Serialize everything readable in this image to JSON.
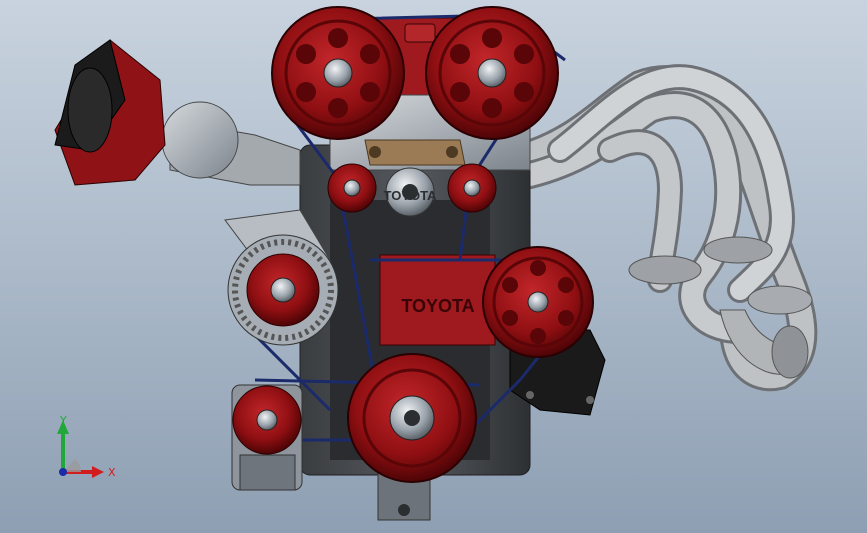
{
  "scene": {
    "brand_text": "TOYOTA",
    "block_text": "TOYOTA",
    "colors": {
      "pulley_red": "#8f0f12",
      "pulley_dark": "#5a0507",
      "metal": "#9aa2ab",
      "metal_dark": "#5b636c",
      "belt": "#1b2a6b",
      "exhaust": "#b9bcc0",
      "gasket": "#1a1a1a",
      "bracket_tan": "#9b7b55"
    }
  },
  "triad": {
    "y_label": "Y",
    "x_label": "X",
    "y_color": "#22a83a",
    "x_color": "#d11d1d"
  }
}
